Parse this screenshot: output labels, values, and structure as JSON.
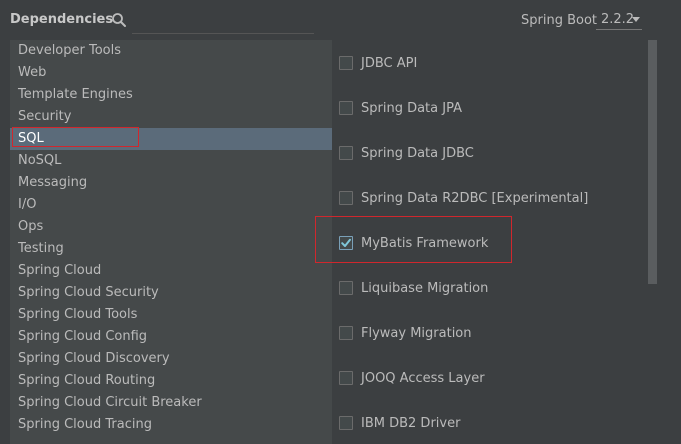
{
  "header": {
    "title": "Dependencies",
    "search_value": "",
    "spring_boot_label": "Spring Boot",
    "spring_boot_version": "2.2.2"
  },
  "categories": [
    {
      "label": "Developer Tools"
    },
    {
      "label": "Web"
    },
    {
      "label": "Template Engines"
    },
    {
      "label": "Security"
    },
    {
      "label": "SQL",
      "selected": true
    },
    {
      "label": "NoSQL"
    },
    {
      "label": "Messaging"
    },
    {
      "label": "I/O"
    },
    {
      "label": "Ops"
    },
    {
      "label": "Testing"
    },
    {
      "label": "Spring Cloud"
    },
    {
      "label": "Spring Cloud Security"
    },
    {
      "label": "Spring Cloud Tools"
    },
    {
      "label": "Spring Cloud Config"
    },
    {
      "label": "Spring Cloud Discovery"
    },
    {
      "label": "Spring Cloud Routing"
    },
    {
      "label": "Spring Cloud Circuit Breaker"
    },
    {
      "label": "Spring Cloud Tracing"
    }
  ],
  "dependencies": [
    {
      "label": "JDBC API",
      "checked": false
    },
    {
      "label": "Spring Data JPA",
      "checked": false
    },
    {
      "label": "Spring Data JDBC",
      "checked": false
    },
    {
      "label": "Spring Data R2DBC [Experimental]",
      "checked": false
    },
    {
      "label": "MyBatis Framework",
      "checked": true
    },
    {
      "label": "Liquibase Migration",
      "checked": false
    },
    {
      "label": "Flyway Migration",
      "checked": false
    },
    {
      "label": "JOOQ Access Layer",
      "checked": false
    },
    {
      "label": "IBM DB2 Driver",
      "checked": false
    }
  ],
  "colors": {
    "background": "#3c3f41",
    "list_background": "#45494a",
    "selected_row": "#5b6b7a",
    "highlight": "#d0272d",
    "check_tick": "#7fc7d9"
  }
}
